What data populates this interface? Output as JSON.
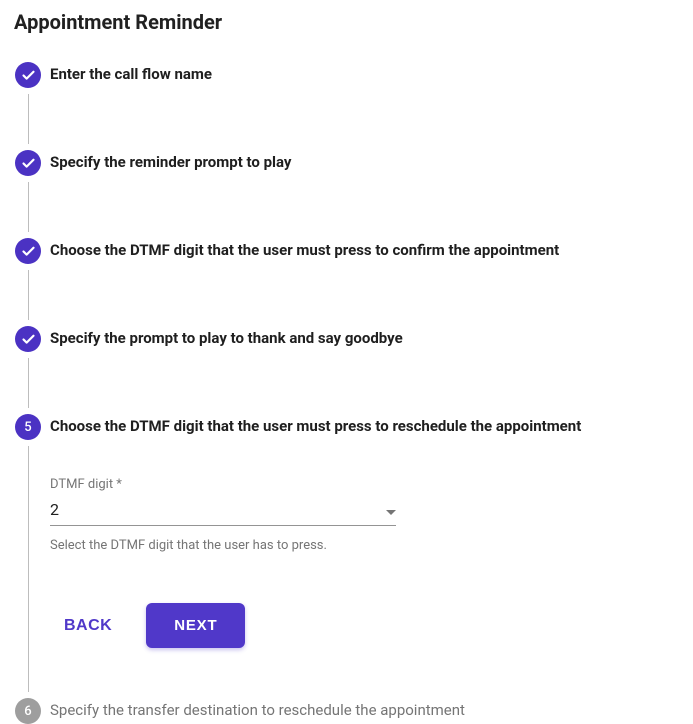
{
  "title": "Appointment Reminder",
  "steps": [
    {
      "label": "Enter the call flow name",
      "state": "done"
    },
    {
      "label": "Specify the reminder prompt to play",
      "state": "done"
    },
    {
      "label": "Choose the DTMF digit that the user must press to confirm the appointment",
      "state": "done"
    },
    {
      "label": "Specify the prompt to play to thank and say goodbye",
      "state": "done"
    },
    {
      "label": "Choose the DTMF digit that the user must press to reschedule the appointment",
      "state": "active",
      "number": "5"
    },
    {
      "label": "Specify the transfer destination to reschedule the appointment",
      "state": "inactive",
      "number": "6"
    }
  ],
  "field": {
    "label": "DTMF digit *",
    "value": "2",
    "hint": "Select the DTMF digit that the user has to press."
  },
  "buttons": {
    "back": "BACK",
    "next": "NEXT"
  },
  "colors": {
    "accent": "#5038c9",
    "inactive": "#9e9e9e"
  }
}
